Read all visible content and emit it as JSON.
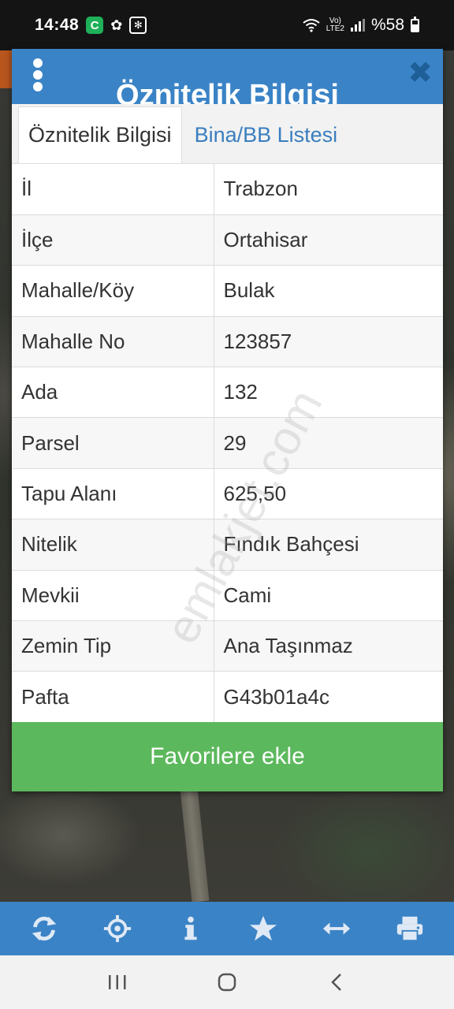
{
  "status_bar": {
    "time": "14:48",
    "network_label_top": "Vo)",
    "network_label_bottom": "LTE2",
    "battery_text": "%58"
  },
  "modal": {
    "title": "Öznitelik Bilgisi",
    "tabs": [
      {
        "label": "Öznitelik Bilgisi",
        "active": true
      },
      {
        "label": "Bina/BB Listesi",
        "active": false
      }
    ],
    "rows": [
      {
        "key": "İl",
        "value": "Trabzon"
      },
      {
        "key": "İlçe",
        "value": "Ortahisar"
      },
      {
        "key": "Mahalle/Köy",
        "value": "Bulak"
      },
      {
        "key": "Mahalle No",
        "value": "123857"
      },
      {
        "key": "Ada",
        "value": "132"
      },
      {
        "key": "Parsel",
        "value": "29"
      },
      {
        "key": "Tapu Alanı",
        "value": "625,50"
      },
      {
        "key": "Nitelik",
        "value": "Fındık Bahçesi"
      },
      {
        "key": "Mevkii",
        "value": "Cami"
      },
      {
        "key": "Zemin Tip",
        "value": "Ana Taşınmaz"
      },
      {
        "key": "Pafta",
        "value": "G43b01a4c"
      }
    ],
    "favorite_button": "Favorilere ekle"
  },
  "watermark": "emlakjet.com",
  "toolbar": {
    "icons": [
      "refresh-icon",
      "locate-icon",
      "info-icon",
      "star-icon",
      "measure-icon",
      "print-icon"
    ]
  },
  "colors": {
    "header_blue": "#3a83c6",
    "button_green": "#5cb85c",
    "tab_link_blue": "#3a7ebf"
  }
}
